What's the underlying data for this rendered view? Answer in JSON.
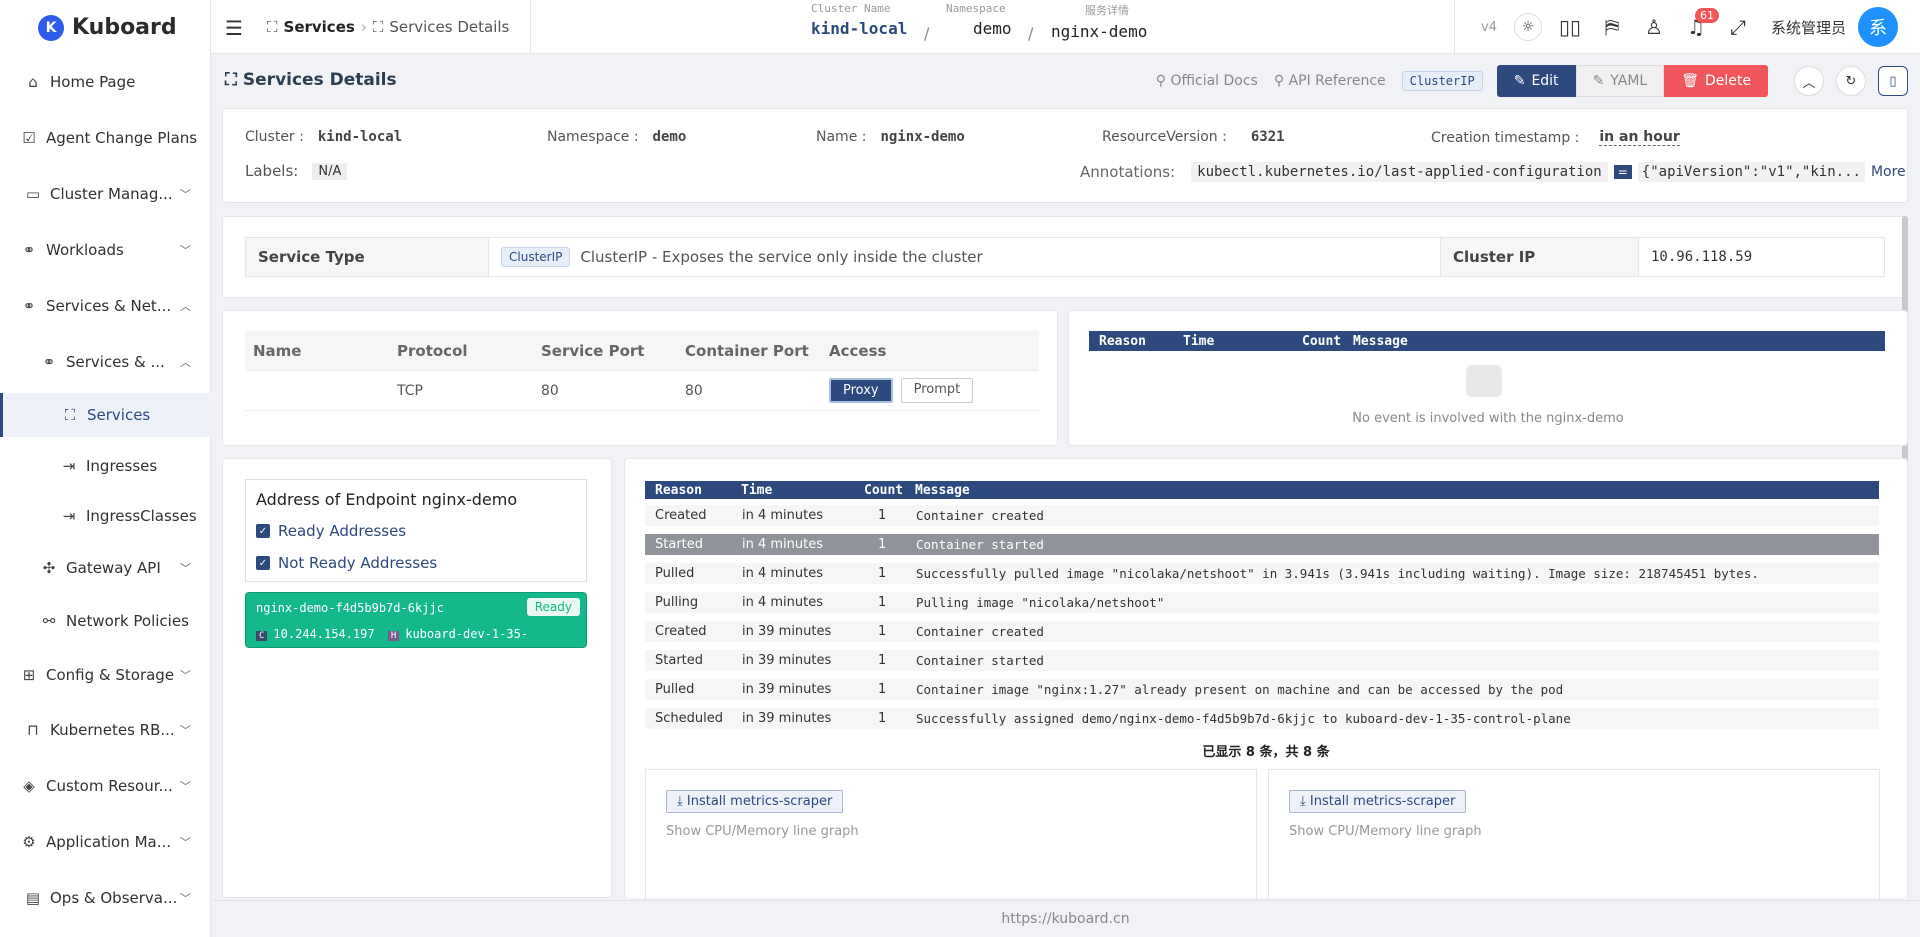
{
  "app": {
    "logo_letter": "K",
    "name": "Kuboard"
  },
  "sidebar": {
    "items": [
      {
        "label": "Home Page",
        "icon": "home-icon",
        "glyph": "⌂"
      },
      {
        "label": "Agent Change Plans",
        "icon": "checklist-icon",
        "glyph": "☑"
      },
      {
        "label": "Cluster Manag...",
        "icon": "monitor-icon",
        "glyph": "▭"
      },
      {
        "label": "Workloads",
        "icon": "workloads-icon",
        "glyph": "⚭"
      },
      {
        "label": "Services & Net...",
        "icon": "network-icon",
        "glyph": "⚭"
      },
      {
        "label": "Services & ...",
        "icon": "network-icon",
        "glyph": "⚭"
      },
      {
        "label": "Services",
        "icon": "service-icon",
        "glyph": "⛶"
      },
      {
        "label": "Ingresses",
        "icon": "ingress-icon",
        "glyph": "⇥"
      },
      {
        "label": "IngressClasses",
        "icon": "ingress-class-icon",
        "glyph": "⇥"
      },
      {
        "label": "Gateway API",
        "icon": "gateway-icon",
        "glyph": "✣"
      },
      {
        "label": "Network Policies",
        "icon": "policy-icon",
        "glyph": "⚯"
      },
      {
        "label": "Config & Storage",
        "icon": "storage-icon",
        "glyph": "⊞"
      },
      {
        "label": "Kubernetes RB...",
        "icon": "lock-icon",
        "glyph": "🔒"
      },
      {
        "label": "Custom Resour...",
        "icon": "layers-icon",
        "glyph": "◈"
      },
      {
        "label": "Application Ma...",
        "icon": "gear-icon",
        "glyph": "⚙"
      },
      {
        "label": "Ops & Observa...",
        "icon": "ops-icon",
        "glyph": "▤"
      }
    ]
  },
  "topbar": {
    "crumb_root": "Services",
    "crumb_current": "Services Details",
    "ctx_cluster_label": "Cluster Name",
    "ctx_cluster": "kind-local",
    "ctx_ns_label": "Namespace",
    "ctx_ns": "demo",
    "ctx_detail_label": "服务详情",
    "ctx_detail": "nginx-demo",
    "sep": "/",
    "version": "v4",
    "notifications": "61",
    "user": "系统管理员",
    "avatar": "系"
  },
  "header": {
    "title": "Services Details",
    "docs": "Official Docs",
    "api": "API Reference",
    "type_tag": "ClusterIP",
    "edit": "Edit",
    "yaml": "YAML",
    "delete": "Delete"
  },
  "meta": {
    "cluster_label": "Cluster :",
    "cluster": "kind-local",
    "namespace_label": "Namespace :",
    "namespace": "demo",
    "name_label": "Name :",
    "name": "nginx-demo",
    "rv_label": "ResourceVersion :",
    "rv": "6321",
    "ct_label": "Creation timestamp :",
    "ct": "in an hour",
    "labels_label": "Labels:",
    "labels": "N/A",
    "annotations_label": "Annotations:",
    "anno_key": "kubectl.kubernetes.io/last-applied-configuration",
    "anno_eq": "=",
    "anno_val": "{\"apiVersion\":\"v1\",\"kin...",
    "more": "More"
  },
  "service": {
    "type_label": "Service Type",
    "type_tag": "ClusterIP",
    "type_desc": "ClusterIP - Exposes the service only inside the cluster",
    "ip_label": "Cluster IP",
    "ip": "10.96.118.59"
  },
  "ports": {
    "headers": [
      "Name",
      "Protocol",
      "Service Port",
      "Container Port",
      "Access"
    ],
    "rows": [
      {
        "name": "",
        "protocol": "TCP",
        "service_port": "80",
        "container_port": "80",
        "proxy": "Proxy",
        "prompt": "Prompt"
      }
    ]
  },
  "events_small": {
    "headers": [
      "Reason",
      "Time",
      "Count",
      "Message"
    ],
    "empty": "No event is involved with the nginx-demo"
  },
  "endpoint": {
    "title": "Address of Endpoint nginx-demo",
    "ready": "Ready Addresses",
    "not_ready": "Not Ready Addresses",
    "pod": "nginx-demo-f4d5b9b7d-6kjjc",
    "status": "Ready",
    "ip_tag": "C",
    "ip": "10.244.154.197",
    "host_tag": "H",
    "host": "kuboard-dev-1-35-"
  },
  "events": {
    "headers": [
      "Reason",
      "Time",
      "Count",
      "Message"
    ],
    "rows": [
      {
        "reason": "Created",
        "time": "in 4 minutes",
        "count": "1",
        "message": "Container created"
      },
      {
        "reason": "Started",
        "time": "in 4 minutes",
        "count": "1",
        "message": "Container started"
      },
      {
        "reason": "Pulled",
        "time": "in 4 minutes",
        "count": "1",
        "message": "Successfully pulled image \"nicolaka/netshoot\" in 3.941s (3.941s including waiting). Image size: 218745451 bytes."
      },
      {
        "reason": "Pulling",
        "time": "in 4 minutes",
        "count": "1",
        "message": "Pulling image \"nicolaka/netshoot\""
      },
      {
        "reason": "Created",
        "time": "in 39 minutes",
        "count": "1",
        "message": "Container created"
      },
      {
        "reason": "Started",
        "time": "in 39 minutes",
        "count": "1",
        "message": "Container started"
      },
      {
        "reason": "Pulled",
        "time": "in 39 minutes",
        "count": "1",
        "message": "Container image \"nginx:1.27\" already present on machine and can be accessed by the pod"
      },
      {
        "reason": "Scheduled",
        "time": "in 39 minutes",
        "count": "1",
        "message": "Successfully assigned demo/nginx-demo-f4d5b9b7d-6kjjc to kuboard-dev-1-35-control-plane"
      }
    ],
    "summary": "已显示 8 条，共 8 条"
  },
  "metrics": {
    "install": "Install metrics-scraper",
    "desc": "Show CPU/Memory line graph"
  },
  "footer": {
    "url": "https://kuboard.cn"
  },
  "colors": {
    "primary": "#2c4a7e",
    "danger": "#f0565c",
    "ready": "#14b88a"
  }
}
